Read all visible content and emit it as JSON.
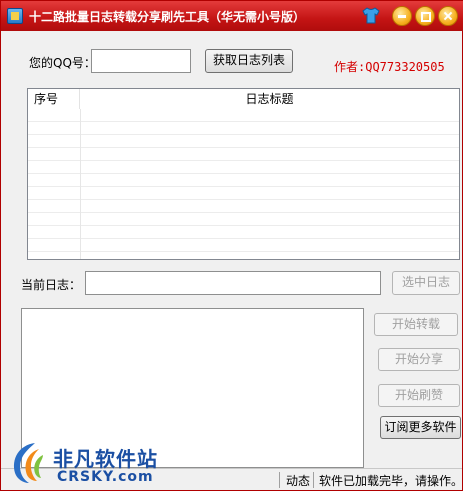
{
  "window": {
    "title": "十二路批量日志转载分享刷先工具（华无需小号版）"
  },
  "form": {
    "qq_label": "您的QQ号：",
    "qq_value": "",
    "fetch_button": "获取日志列表",
    "author_text": "作者:QQ773320505"
  },
  "list": {
    "columns": [
      "序号",
      "日志标题"
    ],
    "rows": []
  },
  "current": {
    "label": "当前日志：",
    "value": "",
    "select_button": "选中日志"
  },
  "actions": {
    "start_repost": "开始转载",
    "start_share": "开始分享",
    "start_refresh": "开始刷赞",
    "subscribe": "订阅更多软件"
  },
  "log": {
    "content": ""
  },
  "statusbar": {
    "dynamic_label": "动态",
    "message": "软件已加载完毕，请操作。"
  },
  "watermark": {
    "cn": "非凡软件站",
    "en": "CRSKY.com"
  },
  "colors": {
    "titlebar": "#c41414",
    "author": "#d40000",
    "watermark": "#1b4fa3"
  },
  "icons": {
    "app": "app-icon",
    "skin": "tshirt-icon",
    "minimize": "minimize-icon",
    "maximize": "maximize-icon",
    "close": "close-icon"
  }
}
